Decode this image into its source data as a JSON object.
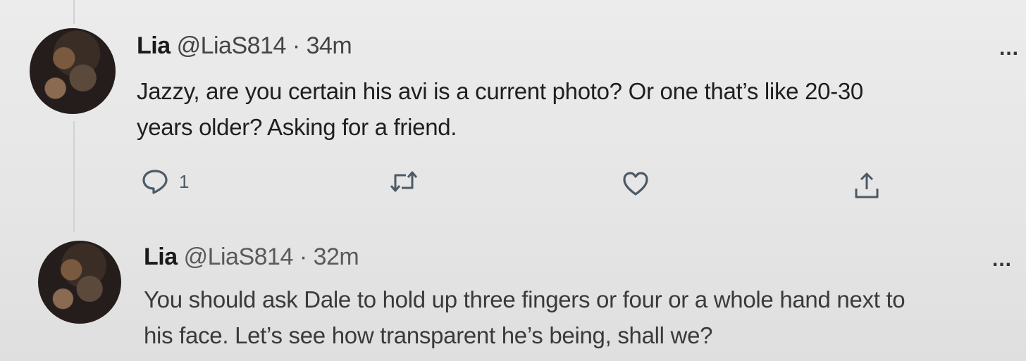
{
  "tweets": [
    {
      "name": "Lia",
      "handle": "@LiaS814",
      "separator": "·",
      "time": "34m",
      "text_lines": [
        "Jazzy, are you certain his avi is a current photo? Or one that’s like 20-30",
        "years older?  Asking for a friend."
      ],
      "more_label": "...",
      "actions": {
        "reply_count": "1",
        "retweet_count": "",
        "like_count": "",
        "share": ""
      }
    },
    {
      "name": "Lia",
      "handle": "@LiaS814",
      "separator": "·",
      "time": "32m",
      "text_lines": [
        "You should ask Dale to hold up three fingers or four or a whole hand next to",
        "his face. Let’s see how transparent he’s being, shall we?"
      ],
      "more_label": "..."
    }
  ],
  "icons": {
    "reply": "reply-icon",
    "retweet": "retweet-icon",
    "like": "heart-icon",
    "share": "share-icon"
  },
  "colors": {
    "background": "#e9e9e9",
    "icon": "#4d5a65",
    "thread_line": "#cfd3d6"
  }
}
